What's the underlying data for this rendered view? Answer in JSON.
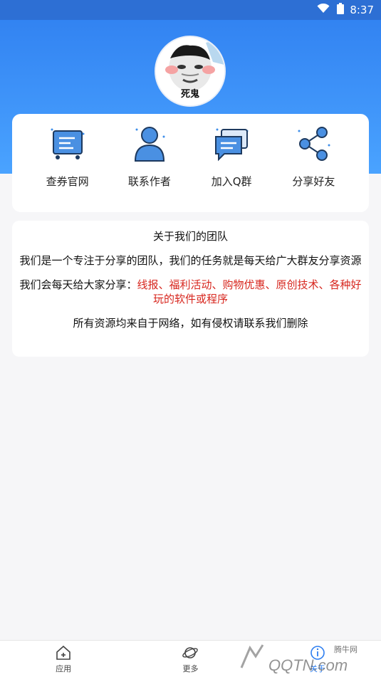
{
  "status_bar": {
    "time": "8:37"
  },
  "profile": {
    "avatar_caption": "死鬼"
  },
  "menu": [
    {
      "label": "查券官网",
      "icon": "cart-icon"
    },
    {
      "label": "联系作者",
      "icon": "user-icon"
    },
    {
      "label": "加入Q群",
      "icon": "chat-icon"
    },
    {
      "label": "分享好友",
      "icon": "share-icon"
    }
  ],
  "about": {
    "title": "关于我们的团队",
    "p1": "我们是一个专注于分享的团队，我们的任务就是每天给广大群友分享资源",
    "p2_prefix": "我们会每天给大家分享：",
    "p2_highlight": "线报、福利活动、购物优惠、原创技术、各种好玩的软件或程序",
    "p3": "所有资源均来自于网络，如有侵权请联系我们删除"
  },
  "bottom_nav": [
    {
      "label": "应用",
      "icon": "home-icon"
    },
    {
      "label": "更多",
      "icon": "planet-icon"
    },
    {
      "label": "关于",
      "icon": "info-icon"
    }
  ],
  "watermark": {
    "text": "腾牛网",
    "logo_text": "QQTN.com"
  }
}
